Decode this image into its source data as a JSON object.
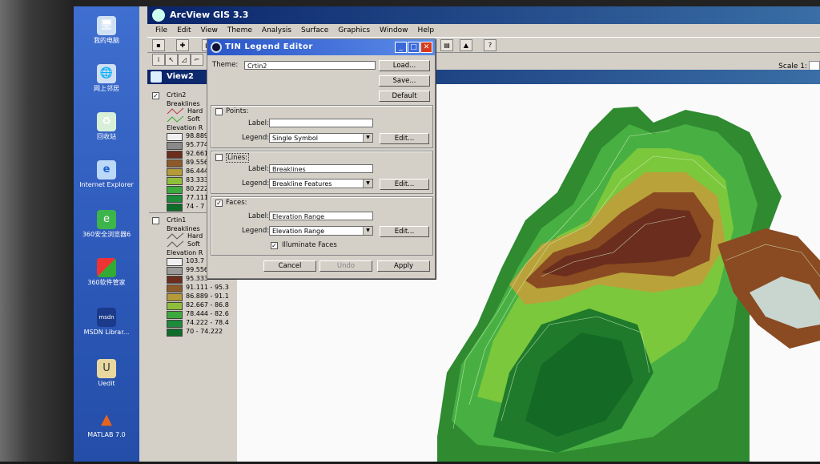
{
  "desktop": {
    "icons": [
      {
        "label": "我的电脑",
        "icon": "computer-icon"
      },
      {
        "label": "网上邻居",
        "icon": "network-icon"
      },
      {
        "label": "回收站",
        "icon": "recycle-bin-icon"
      },
      {
        "label": "Internet Explorer",
        "icon": "ie-icon"
      },
      {
        "label": "360安全浏览器6",
        "icon": "browser-360-icon"
      },
      {
        "label": "360软件管家",
        "icon": "software-manager-icon"
      },
      {
        "label": "MSDN Librar...",
        "icon": "msdn-icon"
      },
      {
        "label": "Uedit",
        "icon": "uedit-icon"
      },
      {
        "label": "MATLAB 7.0",
        "icon": "matlab-icon"
      }
    ]
  },
  "app": {
    "title": "ArcView GIS 3.3",
    "menu": [
      "File",
      "Edit",
      "View",
      "Theme",
      "Analysis",
      "Surface",
      "Graphics",
      "Window",
      "Help"
    ],
    "scale_label": "Scale 1:",
    "view_title": "View2"
  },
  "toc": {
    "theme1": {
      "name": "Crtin2",
      "breaklines_label": "Breaklines",
      "hard": "Hard",
      "soft": "Soft",
      "elev_label": "Elevation R",
      "classes": [
        "98.889",
        "95.774",
        "92.661",
        "89.556",
        "86.444",
        "83.333",
        "80.222",
        "77.111",
        "74 - 7"
      ],
      "colors": [
        "#f0f0f0",
        "#8a8a8a",
        "#6b2e1e",
        "#8c5a2b",
        "#b59a3a",
        "#8fbf3a",
        "#3caa3c",
        "#1d8a3c",
        "#0f6b2a"
      ]
    },
    "theme2": {
      "name": "Crtin1",
      "breaklines_label": "Breaklines",
      "hard": "Hard",
      "soft": "Soft",
      "elev_label": "Elevation R",
      "classes": [
        "103.7",
        "99.556",
        "95.333",
        "91.111 - 95.3",
        "86.889 - 91.1",
        "82.667 - 86.8",
        "78.444 - 82.6",
        "74.222 - 78.4",
        "70 - 74.222"
      ],
      "colors": [
        "#f0f0f0",
        "#9a9a9a",
        "#6b2e1e",
        "#8c5a2b",
        "#b59a3a",
        "#8fbf3a",
        "#3caa3c",
        "#1d8a3c",
        "#0f6b2a"
      ]
    }
  },
  "dialog": {
    "title": "TIN Legend Editor",
    "theme_label": "Theme:",
    "theme_value": "Crtin2",
    "load": "Load...",
    "save": "Save...",
    "default": "Default",
    "points_label": "Points:",
    "points_text_label": "Label:",
    "points_label_value": "",
    "points_legend_label": "Legend:",
    "points_legend_value": "Single Symbol",
    "lines_label": "Lines:",
    "lines_text_label": "Label:",
    "lines_label_value": "Breaklines",
    "lines_legend_label": "Legend:",
    "lines_legend_value": "Breakline Features",
    "faces_label": "Faces:",
    "faces_text_label": "Label:",
    "faces_label_value": "Elevation Range",
    "faces_legend_label": "Legend:",
    "faces_legend_value": "Elevation Range",
    "illuminate": "Illuminate Faces",
    "edit": "Edit...",
    "cancel": "Cancel",
    "undo": "Undo",
    "apply": "Apply"
  }
}
